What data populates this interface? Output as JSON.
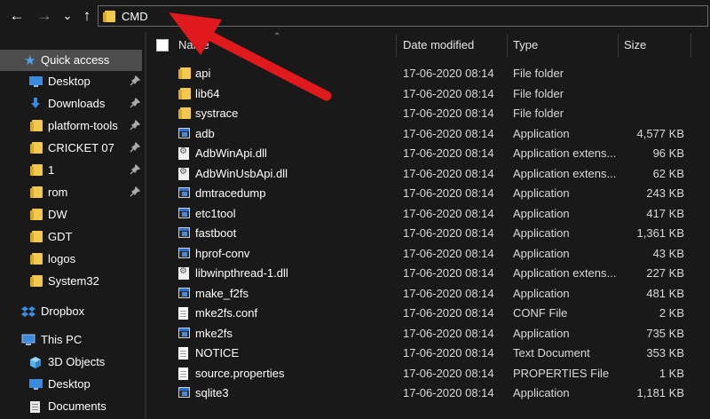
{
  "nav": {
    "back": "←",
    "forward": "→",
    "recent": "⌄",
    "up": "↑"
  },
  "address": {
    "text": "CMD"
  },
  "columns": {
    "name": "Name",
    "date": "Date modified",
    "type": "Type",
    "size": "Size"
  },
  "sidebar": {
    "items": [
      {
        "label": "Quick access",
        "icon": "star-icon"
      },
      {
        "label": "Desktop",
        "icon": "desktop-icon"
      },
      {
        "label": "Downloads",
        "icon": "download-icon"
      },
      {
        "label": "platform-tools",
        "icon": "folder-icon"
      },
      {
        "label": "CRICKET 07",
        "icon": "folder-icon"
      },
      {
        "label": "1",
        "icon": "folder-icon"
      },
      {
        "label": "rom",
        "icon": "folder-icon"
      },
      {
        "label": "DW",
        "icon": "folder-icon"
      },
      {
        "label": "GDT",
        "icon": "folder-icon"
      },
      {
        "label": "logos",
        "icon": "folder-icon"
      },
      {
        "label": "System32",
        "icon": "folder-icon"
      },
      {
        "label": "Dropbox",
        "icon": "dropbox-icon"
      },
      {
        "label": "This PC",
        "icon": "pc-icon"
      },
      {
        "label": "3D Objects",
        "icon": "cube-icon"
      },
      {
        "label": "Desktop",
        "icon": "desktop-icon"
      },
      {
        "label": "Documents",
        "icon": "documents-icon"
      }
    ]
  },
  "files": [
    {
      "name": "api",
      "date": "17-06-2020 08:14",
      "type": "File folder",
      "size": "",
      "icon": "folder"
    },
    {
      "name": "lib64",
      "date": "17-06-2020 08:14",
      "type": "File folder",
      "size": "",
      "icon": "folder"
    },
    {
      "name": "systrace",
      "date": "17-06-2020 08:14",
      "type": "File folder",
      "size": "",
      "icon": "folder"
    },
    {
      "name": "adb",
      "date": "17-06-2020 08:14",
      "type": "Application",
      "size": "4,577 KB",
      "icon": "app"
    },
    {
      "name": "AdbWinApi.dll",
      "date": "17-06-2020 08:14",
      "type": "Application extens...",
      "size": "96 KB",
      "icon": "dll"
    },
    {
      "name": "AdbWinUsbApi.dll",
      "date": "17-06-2020 08:14",
      "type": "Application extens...",
      "size": "62 KB",
      "icon": "dll"
    },
    {
      "name": "dmtracedump",
      "date": "17-06-2020 08:14",
      "type": "Application",
      "size": "243 KB",
      "icon": "app"
    },
    {
      "name": "etc1tool",
      "date": "17-06-2020 08:14",
      "type": "Application",
      "size": "417 KB",
      "icon": "app"
    },
    {
      "name": "fastboot",
      "date": "17-06-2020 08:14",
      "type": "Application",
      "size": "1,361 KB",
      "icon": "app"
    },
    {
      "name": "hprof-conv",
      "date": "17-06-2020 08:14",
      "type": "Application",
      "size": "43 KB",
      "icon": "app"
    },
    {
      "name": "libwinpthread-1.dll",
      "date": "17-06-2020 08:14",
      "type": "Application extens...",
      "size": "227 KB",
      "icon": "dll"
    },
    {
      "name": "make_f2fs",
      "date": "17-06-2020 08:14",
      "type": "Application",
      "size": "481 KB",
      "icon": "app"
    },
    {
      "name": "mke2fs.conf",
      "date": "17-06-2020 08:14",
      "type": "CONF File",
      "size": "2 KB",
      "icon": "doc"
    },
    {
      "name": "mke2fs",
      "date": "17-06-2020 08:14",
      "type": "Application",
      "size": "735 KB",
      "icon": "app"
    },
    {
      "name": "NOTICE",
      "date": "17-06-2020 08:14",
      "type": "Text Document",
      "size": "353 KB",
      "icon": "doc"
    },
    {
      "name": "source.properties",
      "date": "17-06-2020 08:14",
      "type": "PROPERTIES File",
      "size": "1 KB",
      "icon": "doc"
    },
    {
      "name": "sqlite3",
      "date": "17-06-2020 08:14",
      "type": "Application",
      "size": "1,181 KB",
      "icon": "app"
    }
  ],
  "colors": {
    "background": "#191919",
    "selected": "#4d4d4d",
    "folder": "#f2c94c",
    "annotation_arrow": "#e0191c"
  }
}
